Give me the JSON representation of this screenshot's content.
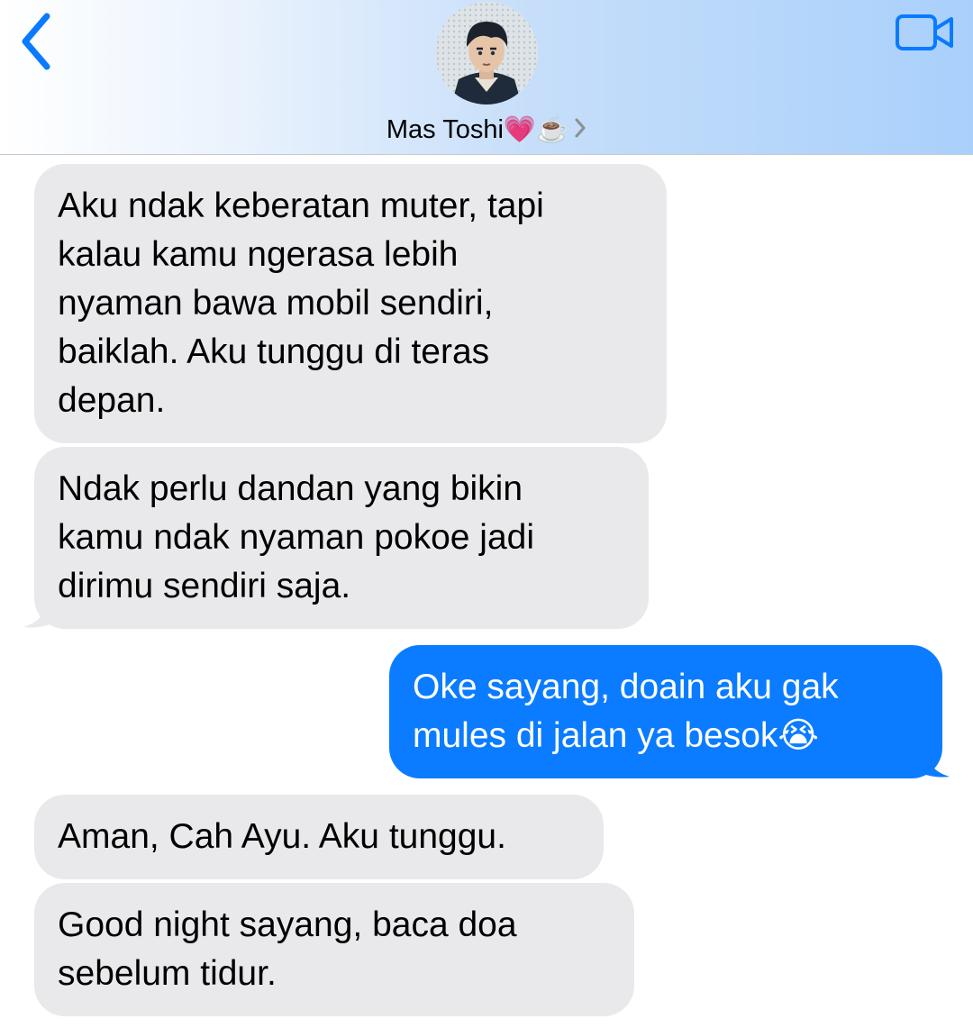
{
  "header": {
    "back_icon": "chevron-left-icon",
    "video_icon": "video-camera-icon",
    "contact_name": "Mas Toshi",
    "contact_emoji": "💗☕️",
    "colors": {
      "accent": "#0a7aff",
      "header_start": "#ffffff",
      "header_end": "#a9d0fb"
    }
  },
  "messages": [
    {
      "direction": "incoming",
      "text": "Aku ndak keberatan muter, tapi\nkalau kamu ngerasa lebih\nnyaman bawa mobil sendiri,\nbaiklah. Aku tunggu di teras\ndepan."
    },
    {
      "direction": "incoming",
      "text": "Ndak perlu dandan yang bikin\nkamu ndak nyaman pokoe jadi\ndirimu sendiri saja."
    },
    {
      "direction": "outgoing",
      "text": "Oke sayang, doain aku gak\nmules di jalan ya besok😭"
    },
    {
      "direction": "incoming",
      "text": "Aman, Cah Ayu. Aku tunggu."
    },
    {
      "direction": "incoming",
      "text": "Good night sayang, baca doa\nsebelum tidur."
    }
  ],
  "colors": {
    "incoming_bubble": "#e9e9eb",
    "outgoing_bubble": "#0b7cff",
    "incoming_text": "#000000",
    "outgoing_text": "#ffffff"
  }
}
